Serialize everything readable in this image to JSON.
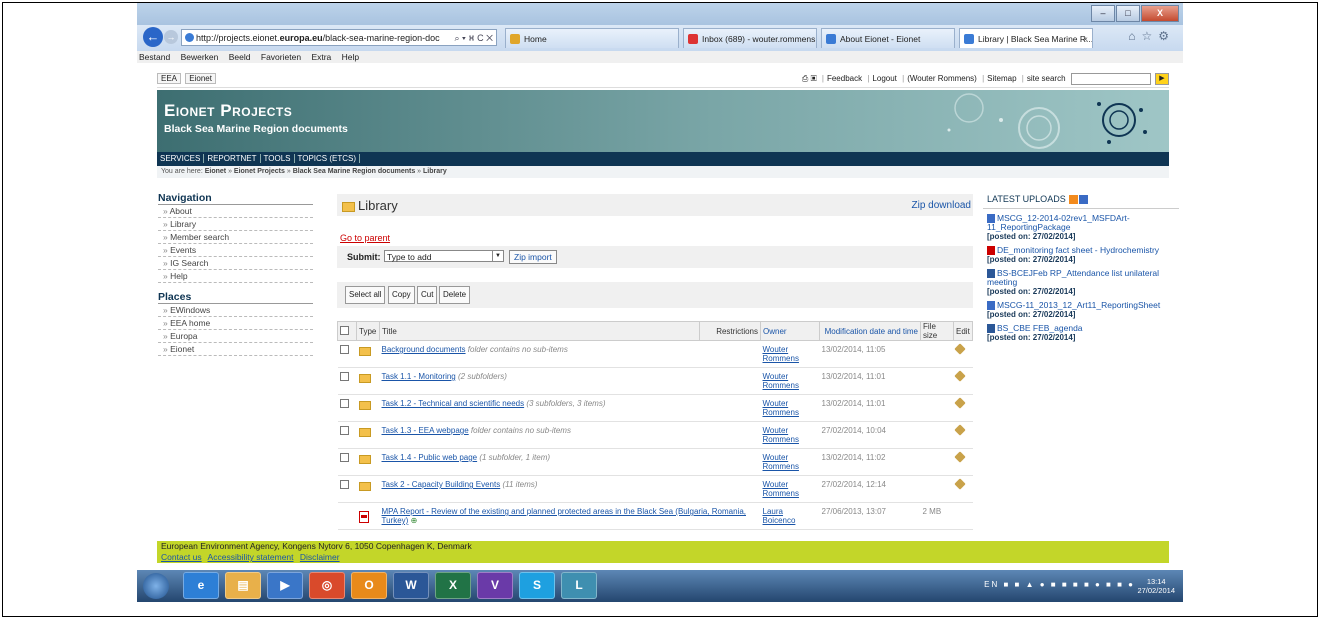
{
  "browser": {
    "url_prefix": "http://projects.eionet.",
    "url_domain": "europa.eu",
    "url_rest": "/black-sea-marine-region-doc",
    "url_controls": "⌕ ▾ ⌘ C ✕",
    "tabs": [
      {
        "label": "Home",
        "color": "#e0a62a"
      },
      {
        "label": "Inbox (689) - wouter.rommens...",
        "color": "#d33"
      },
      {
        "label": "About Eionet - Eionet",
        "color": "#3a7bd5"
      },
      {
        "label": "Library | Black Sea Marine R...",
        "color": "#3a7bd5",
        "close": "×"
      }
    ],
    "menu": [
      "Bestand",
      "Bewerken",
      "Beeld",
      "Favorieten",
      "Extra",
      "Help"
    ],
    "window_buttons": {
      "min": "–",
      "max": "□",
      "close": "X"
    }
  },
  "site": {
    "top_left": [
      "EEA",
      "Eionet"
    ],
    "top_right": [
      "Feedback",
      "Logout",
      "(Wouter Rommens)",
      "Sitemap"
    ],
    "search_label": "site search",
    "banner_title": "Eionet Projects",
    "banner_subtitle": "Black Sea Marine Region documents",
    "topnav": [
      "SERVICES",
      "REPORTNET",
      "TOOLS",
      "TOPICS (ETCS)"
    ],
    "breadcrumb_prefix": "You are here:",
    "breadcrumb": [
      "Eionet",
      "Eionet Projects",
      "Black Sea Marine Region documents",
      "Library"
    ]
  },
  "navigation": {
    "title": "Navigation",
    "items": [
      "About",
      "Library",
      "Member search",
      "Events",
      "IG Search",
      "Help"
    ],
    "places_title": "Places",
    "places": [
      "EWindows",
      "EEA home",
      "Europa",
      "Eionet"
    ]
  },
  "library": {
    "title": "Library",
    "zip_download": "Zip download",
    "go_to_parent": "Go to parent",
    "submit_label": "Submit:",
    "submit_select": "Type to add",
    "zip_import": "Zip import",
    "actions": [
      "Select all",
      "Copy",
      "Cut",
      "Delete"
    ],
    "columns": [
      "Type",
      "Title",
      "Restrictions",
      "Owner",
      "Modification date and time",
      "File size",
      "Edit"
    ],
    "rows": [
      {
        "title": "Background documents",
        "note": "folder contains no sub-items",
        "owner1": "Wouter",
        "owner2": "Rommens",
        "date": "13/02/2014, 11:05",
        "size": ""
      },
      {
        "title": "Task 1.1 - Monitoring",
        "note": "(2 subfolders)",
        "owner1": "Wouter",
        "owner2": "Rommens",
        "date": "13/02/2014, 11:01",
        "size": ""
      },
      {
        "title": "Task 1.2 - Technical and scientific needs",
        "note": "(3 subfolders, 3 items)",
        "owner1": "Wouter",
        "owner2": "Rommens",
        "date": "13/02/2014, 11:01",
        "size": ""
      },
      {
        "title": "Task 1.3 - EEA webpage",
        "note": "folder contains no sub-items",
        "owner1": "Wouter",
        "owner2": "Rommens",
        "date": "27/02/2014, 10:04",
        "size": ""
      },
      {
        "title": "Task 1.4 - Public web page",
        "note": "(1 subfolder, 1 item)",
        "owner1": "Wouter",
        "owner2": "Rommens",
        "date": "13/02/2014, 11:02",
        "size": ""
      },
      {
        "title": "Task 2 - Capacity Building Events",
        "note": "(11 items)",
        "owner1": "Wouter",
        "owner2": "Rommens",
        "date": "27/02/2014, 12:14",
        "size": ""
      },
      {
        "title": "MPA Report - Review of the existing and planned protected areas in the Black Sea (Bulgaria, Romania, Turkey)",
        "note": "",
        "owner1": "Laura Boicenco",
        "owner2": "",
        "date": "27/06/2013, 13:07",
        "size": "2 MB"
      }
    ]
  },
  "latest": {
    "title": "LATEST UPLOADS",
    "items": [
      {
        "name": "MSCG_12-2014-02rev1_MSFDArt-11_ReportingPackage",
        "posted": "[posted on: 27/02/2014]",
        "icon_color": "#3a6bc4"
      },
      {
        "name": "DE_monitoring fact sheet - Hydrochemistry",
        "posted": "[posted on: 27/02/2014]",
        "icon_color": "#c00"
      },
      {
        "name": "BS-BCEJFeb RP_Attendance list unilateral meeting",
        "posted": "[posted on: 27/02/2014]",
        "icon_color": "#2b5797"
      },
      {
        "name": "MSCG-11_2013_12_Art11_ReportingSheet",
        "posted": "[posted on: 27/02/2014]",
        "icon_color": "#3a6bc4"
      },
      {
        "name": "BS_CBE FEB_agenda",
        "posted": "[posted on: 27/02/2014]",
        "icon_color": "#2b5797"
      }
    ]
  },
  "footer": {
    "address": "European Environment Agency, Kongens Nytorv 6, 1050 Copenhagen K, Denmark",
    "links": [
      "Contact us",
      "Accessibility statement",
      "Disclaimer"
    ]
  },
  "taskbar": {
    "apps": [
      "e",
      "▤",
      "▶",
      "◎",
      "O",
      "W",
      "X",
      "V",
      "S",
      "L"
    ],
    "tray": "EN",
    "time": "13:14",
    "date": "27/02/2014"
  }
}
